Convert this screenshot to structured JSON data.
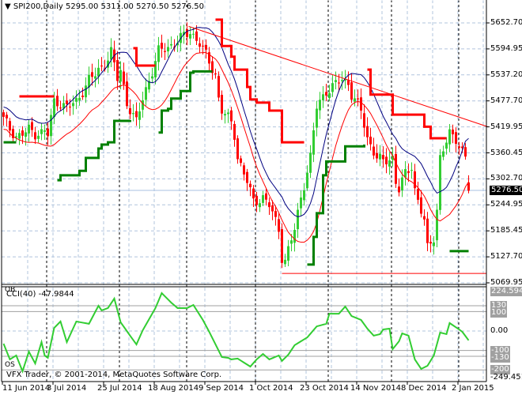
{
  "header": {
    "arrow": "▼",
    "symbol": "SPI200,Daily",
    "open": "5295.00",
    "high": "5311.00",
    "low": "5270.50",
    "close": "5276.50"
  },
  "price_scale": [
    "5652.70",
    "5594.95",
    "5537.20",
    "5477.70",
    "5419.95",
    "5360.45",
    "5302.70",
    "5244.95",
    "5185.45",
    "5127.70",
    "5069.95"
  ],
  "bid_label": "5276.50",
  "indicator": {
    "name": "CCI(40) -47.9844",
    "ob": "OB",
    "os": "OS",
    "max": "224.5949",
    "min": "-249.451",
    "levels": [
      "130",
      "100",
      "0.00",
      "-100",
      "-130",
      "-200"
    ]
  },
  "copyright": "VFX Trader, © 2001-2014, MetaQuotes Software Corp.",
  "time_labels": [
    "11 Jun 2014",
    "3 Jul 2014",
    "25 Jul 2014",
    "18 Aug 2014",
    "9 Sep 2014",
    "1 Oct 2014",
    "23 Oct 2014",
    "14 Nov 2014",
    "8 Dec 2014",
    "2 Jan 2015"
  ],
  "colors": {
    "bull": "#32cd32",
    "bear": "#ff0000",
    "ma_fast": "#000080",
    "ma_slow": "#ff0000",
    "stop_red": "#ff0000",
    "stop_green": "#008000",
    "cci": "#32cd32",
    "grid": "#b0c4de"
  },
  "chart_data": {
    "type": "candlestick",
    "title": "SPI200,Daily",
    "ylim": [
      5069.95,
      5652.7
    ],
    "bars": 148,
    "close_keypoints": [
      [
        0,
        5438
      ],
      [
        2,
        5412
      ],
      [
        4,
        5399
      ],
      [
        8,
        5412
      ],
      [
        10,
        5403
      ],
      [
        13,
        5412
      ],
      [
        14,
        5403
      ],
      [
        16,
        5474
      ],
      [
        18,
        5474
      ],
      [
        20,
        5465
      ],
      [
        23,
        5474
      ],
      [
        27,
        5527
      ],
      [
        29,
        5536
      ],
      [
        32,
        5562
      ],
      [
        34,
        5589
      ],
      [
        36,
        5527
      ],
      [
        37,
        5545
      ],
      [
        39,
        5474
      ],
      [
        42,
        5430
      ],
      [
        44,
        5483
      ],
      [
        47,
        5545
      ],
      [
        49,
        5589
      ],
      [
        52,
        5598
      ],
      [
        54,
        5607
      ],
      [
        57,
        5624
      ],
      [
        59,
        5633
      ],
      [
        62,
        5607
      ],
      [
        64,
        5580
      ],
      [
        67,
        5536
      ],
      [
        68,
        5483
      ],
      [
        69,
        5456
      ],
      [
        72,
        5430
      ],
      [
        73,
        5403
      ],
      [
        74,
        5351
      ],
      [
        77,
        5297
      ],
      [
        79,
        5252
      ],
      [
        82,
        5261
      ],
      [
        84,
        5244
      ],
      [
        87,
        5190
      ],
      [
        88,
        5128
      ],
      [
        89,
        5120
      ],
      [
        92,
        5190
      ],
      [
        94,
        5261
      ],
      [
        97,
        5351
      ],
      [
        99,
        5465
      ],
      [
        102,
        5500
      ],
      [
        104,
        5509
      ],
      [
        107,
        5527
      ],
      [
        109,
        5518
      ],
      [
        110,
        5492
      ],
      [
        113,
        5456
      ],
      [
        115,
        5394
      ],
      [
        118,
        5351
      ],
      [
        120,
        5341
      ],
      [
        123,
        5351
      ],
      [
        124,
        5297
      ],
      [
        125,
        5279
      ],
      [
        127,
        5314
      ],
      [
        129,
        5332
      ],
      [
        130,
        5279
      ],
      [
        133,
        5208
      ],
      [
        134,
        5146
      ],
      [
        136,
        5173
      ],
      [
        137,
        5235
      ],
      [
        138,
        5351
      ],
      [
        141,
        5403
      ],
      [
        143,
        5394
      ],
      [
        146,
        5351
      ],
      [
        147,
        5276.5
      ]
    ],
    "last_bar": {
      "open": 5295.0,
      "high": 5311.0,
      "low": 5270.5,
      "close": 5276.5
    },
    "red_stops": [
      [
        [
          5,
          5488
        ],
        [
          16,
          5488
        ]
      ],
      [
        [
          41,
          5596
        ],
        [
          42,
          5557
        ],
        [
          48,
          5557
        ]
      ],
      [
        [
          67,
          5660
        ],
        [
          69,
          5601
        ],
        [
          72,
          5577
        ],
        [
          73,
          5548
        ],
        [
          75,
          5548
        ],
        [
          77,
          5509
        ],
        [
          78,
          5481
        ],
        [
          80,
          5474
        ],
        [
          83,
          5474
        ],
        [
          84,
          5456
        ],
        [
          87,
          5456
        ],
        [
          88,
          5385
        ],
        [
          95,
          5385
        ]
      ],
      [
        [
          115,
          5548
        ],
        [
          116,
          5492
        ],
        [
          122,
          5492
        ],
        [
          123,
          5447
        ],
        [
          132,
          5447
        ],
        [
          133,
          5420
        ],
        [
          135,
          5394
        ],
        [
          140,
          5394
        ]
      ]
    ],
    "green_stops": [
      [
        [
          0,
          5385
        ],
        [
          4,
          5385
        ]
      ],
      [
        [
          17,
          5300
        ],
        [
          18,
          5311
        ],
        [
          22,
          5311
        ],
        [
          24,
          5321
        ],
        [
          26,
          5350
        ],
        [
          29,
          5350
        ],
        [
          30,
          5371
        ],
        [
          31,
          5380
        ],
        [
          33,
          5385
        ],
        [
          35,
          5433
        ],
        [
          40,
          5435
        ]
      ],
      [
        [
          49,
          5407
        ],
        [
          50,
          5456
        ],
        [
          52,
          5460
        ],
        [
          53,
          5483
        ],
        [
          55,
          5483
        ],
        [
          56,
          5500
        ],
        [
          59,
          5541
        ],
        [
          60,
          5544
        ],
        [
          66,
          5544
        ]
      ],
      [
        [
          96,
          5111
        ],
        [
          98,
          5173
        ],
        [
          99,
          5226
        ],
        [
          101,
          5311
        ],
        [
          102,
          5342
        ],
        [
          107,
          5342
        ],
        [
          108,
          5376
        ],
        [
          114,
          5380
        ]
      ],
      [
        [
          141,
          5141
        ],
        [
          147,
          5141
        ]
      ]
    ],
    "trendline": [
      [
        58.5,
        5645
      ],
      [
        153,
        5420
      ]
    ],
    "support_line": {
      "from": 88,
      "to": 153,
      "price": 5091
    },
    "cci": {
      "period": 40,
      "last": -47.9844,
      "ylim": [
        -249.451,
        224.5949
      ],
      "levels": [
        130,
        100,
        0,
        -100,
        -130,
        -200
      ],
      "keypoints": [
        [
          0,
          -65
        ],
        [
          2,
          -146
        ],
        [
          4,
          -126
        ],
        [
          6,
          -207
        ],
        [
          8,
          -106
        ],
        [
          10,
          -167
        ],
        [
          12,
          -57
        ],
        [
          13,
          -126
        ],
        [
          14,
          -138
        ],
        [
          16,
          16
        ],
        [
          18,
          49
        ],
        [
          20,
          -57
        ],
        [
          23,
          49
        ],
        [
          27,
          37
        ],
        [
          30,
          130
        ],
        [
          31,
          106
        ],
        [
          33,
          118
        ],
        [
          35,
          167
        ],
        [
          37,
          45
        ],
        [
          40,
          -24
        ],
        [
          42,
          -69
        ],
        [
          44,
          4
        ],
        [
          48,
          118
        ],
        [
          50,
          195
        ],
        [
          53,
          146
        ],
        [
          55,
          118
        ],
        [
          58,
          118
        ],
        [
          60,
          134
        ],
        [
          63,
          57
        ],
        [
          65,
          -4
        ],
        [
          69,
          -134
        ],
        [
          71,
          -138
        ],
        [
          72,
          -146
        ],
        [
          74,
          -142
        ],
        [
          78,
          -183
        ],
        [
          80,
          -146
        ],
        [
          82,
          -118
        ],
        [
          84,
          -146
        ],
        [
          87,
          -126
        ],
        [
          88,
          -154
        ],
        [
          90,
          -122
        ],
        [
          92,
          -73
        ],
        [
          96,
          -33
        ],
        [
          99,
          24
        ],
        [
          102,
          37
        ],
        [
          103,
          89
        ],
        [
          106,
          89
        ],
        [
          108,
          126
        ],
        [
          110,
          77
        ],
        [
          113,
          57
        ],
        [
          115,
          12
        ],
        [
          117,
          -24
        ],
        [
          119,
          -16
        ],
        [
          120,
          8
        ],
        [
          122,
          12
        ],
        [
          123,
          -93
        ],
        [
          125,
          -53
        ],
        [
          126,
          -12
        ],
        [
          128,
          -24
        ],
        [
          130,
          -146
        ],
        [
          132,
          -195
        ],
        [
          134,
          -179
        ],
        [
          136,
          -126
        ],
        [
          138,
          -8
        ],
        [
          140,
          -16
        ],
        [
          141,
          41
        ],
        [
          144,
          8
        ],
        [
          145,
          -4
        ],
        [
          147,
          -48
        ]
      ]
    }
  }
}
